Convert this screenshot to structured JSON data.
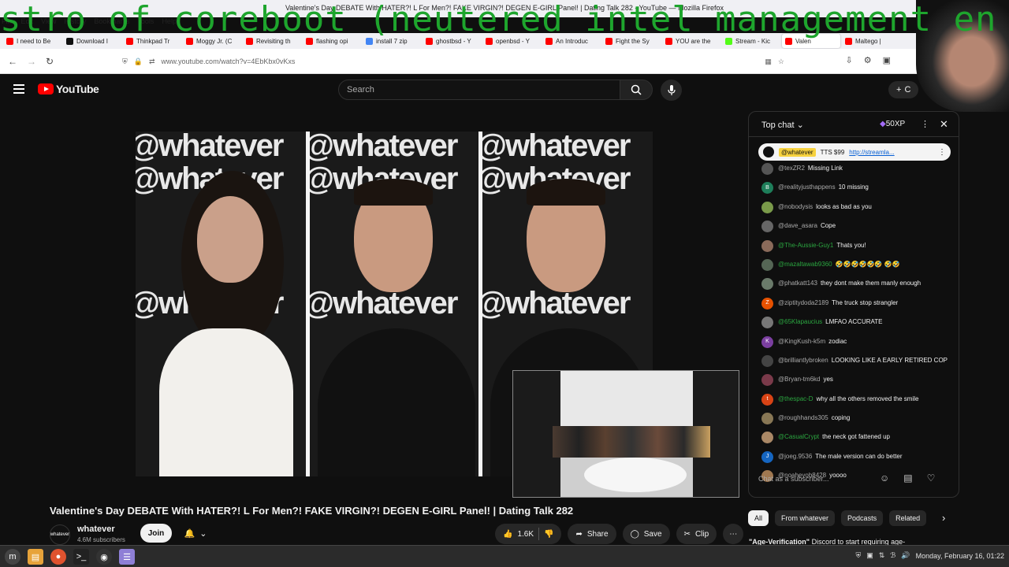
{
  "browser": {
    "window_title": "Valentine's Day DEBATE With HATER?! L For Men?! FAKE VIRGIN?! DEGEN E-GIRL Panel! | Dating Talk 282 - YouTube — Mozilla Firefox",
    "menu": [
      "File",
      "Edit",
      "View",
      "History",
      "Bookmarks",
      "Tools",
      "Help"
    ],
    "overlay_text": "stro of coreboot (neutered intel management en",
    "tabs": [
      {
        "label": "I need to Be",
        "color": "#ff0000"
      },
      {
        "label": "Download I",
        "color": "#111111"
      },
      {
        "label": "Thinkpad Tr",
        "color": "#ff0000"
      },
      {
        "label": "Moggy Jr. (C",
        "color": "#ff0000"
      },
      {
        "label": "Revisiting th",
        "color": "#ff0000"
      },
      {
        "label": "flashing opi",
        "color": "#ff0000"
      },
      {
        "label": "install 7 zip",
        "color": "#4285f4"
      },
      {
        "label": "ghostbsd - Y",
        "color": "#ff0000"
      },
      {
        "label": "openbsd - Y",
        "color": "#ff0000"
      },
      {
        "label": "An Introduc",
        "color": "#ff0000"
      },
      {
        "label": "Fight the Sy",
        "color": "#ff0000"
      },
      {
        "label": "YOU are the",
        "color": "#ff0000"
      },
      {
        "label": "Stream - Kic",
        "color": "#53fc18"
      },
      {
        "label": "Valen",
        "color": "#ff0000",
        "active": true
      },
      {
        "label": "Maltego |",
        "color": "#ff0000"
      }
    ],
    "url": "www.youtube.com/watch?v=4EbKbx0vKxs"
  },
  "youtube": {
    "logo": "YouTube",
    "search_placeholder": "Search",
    "create_label": "C"
  },
  "video": {
    "watermark": "@whatever",
    "title": "Valentine's Day DEBATE With HATER?! L For Men?! FAKE VIRGIN?! DEGEN E-GIRL Panel! | Dating Talk 282",
    "channel": "whatever",
    "channel_avatar_text": "whatever",
    "subscribers": "4.6M subscribers",
    "join": "Join",
    "likes": "1.6K",
    "share": "Share",
    "save": "Save",
    "clip": "Clip"
  },
  "chat": {
    "title": "Top chat",
    "xp": "50XP",
    "pinned": {
      "user": "@whatever",
      "text": "TTS $99",
      "link": "http://streamla..."
    },
    "messages": [
      {
        "user": "@texZR2",
        "text": "Missing Link",
        "av": "#555555",
        "green": false
      },
      {
        "user": "@realityjusthappens",
        "text": "10 missing",
        "av": "#1e7e5a",
        "initial": "B",
        "green": false
      },
      {
        "user": "@nobodysis",
        "text": "looks as bad as you",
        "av": "#7a9a4a",
        "green": false
      },
      {
        "user": "@dave_asara",
        "text": "Cope",
        "av": "#666666",
        "green": false
      },
      {
        "user": "@The-Aussie-Guy1",
        "text": "Thats you!",
        "av": "#8a6a5a",
        "green": true
      },
      {
        "user": "@mazaltawab9360",
        "text": "🤣🤣🤣🤣🤣🤣 🤣🤣",
        "av": "#556655",
        "green": true
      },
      {
        "user": "@phatkatt143",
        "text": "they dont make them manly enough",
        "av": "#6a7a6a",
        "green": false
      },
      {
        "user": "@ziptitydoda2189",
        "text": "The truck stop strangler",
        "av": "#e65100",
        "initial": "Z",
        "green": false
      },
      {
        "user": "@65Klapaucius",
        "text": "LMFAO ACCURATE",
        "av": "#777777",
        "green": true
      },
      {
        "user": "@KingKush-k5m",
        "text": "zodiac",
        "av": "#7b3fa0",
        "initial": "K",
        "green": false
      },
      {
        "user": "@brilliantlybroken",
        "text": "LOOKING LIKE A EARLY RETIRED COP",
        "av": "#444444",
        "green": false
      },
      {
        "user": "@Bryan-tm6kd",
        "text": "yes",
        "av": "#7a3a4a",
        "green": false
      },
      {
        "user": "@thespac-D",
        "text": "why all the others removed the smile",
        "av": "#d84315",
        "initial": "t",
        "green": true
      },
      {
        "user": "@roughhands305",
        "text": "coping",
        "av": "#887755",
        "green": false
      },
      {
        "user": "@CasualCrypt",
        "text": "the neck got fattened up",
        "av": "#aa8866",
        "green": true
      },
      {
        "user": "@joeg.9536",
        "text": "The male version can do better",
        "av": "#1565c0",
        "initial": "J",
        "green": false
      },
      {
        "user": "@noaheyob8428",
        "text": "yoooo",
        "av": "#a07850",
        "green": false
      }
    ],
    "input_placeholder": "Chat as a subscriber..."
  },
  "chips": [
    "All",
    "From whatever",
    "Podcasts",
    "Related"
  ],
  "recommendation": {
    "title": "\"Age-Verification\"",
    "text": "Discord to start requiring age-"
  },
  "taskbar": {
    "clock": "Monday, February 16, 01:22"
  }
}
